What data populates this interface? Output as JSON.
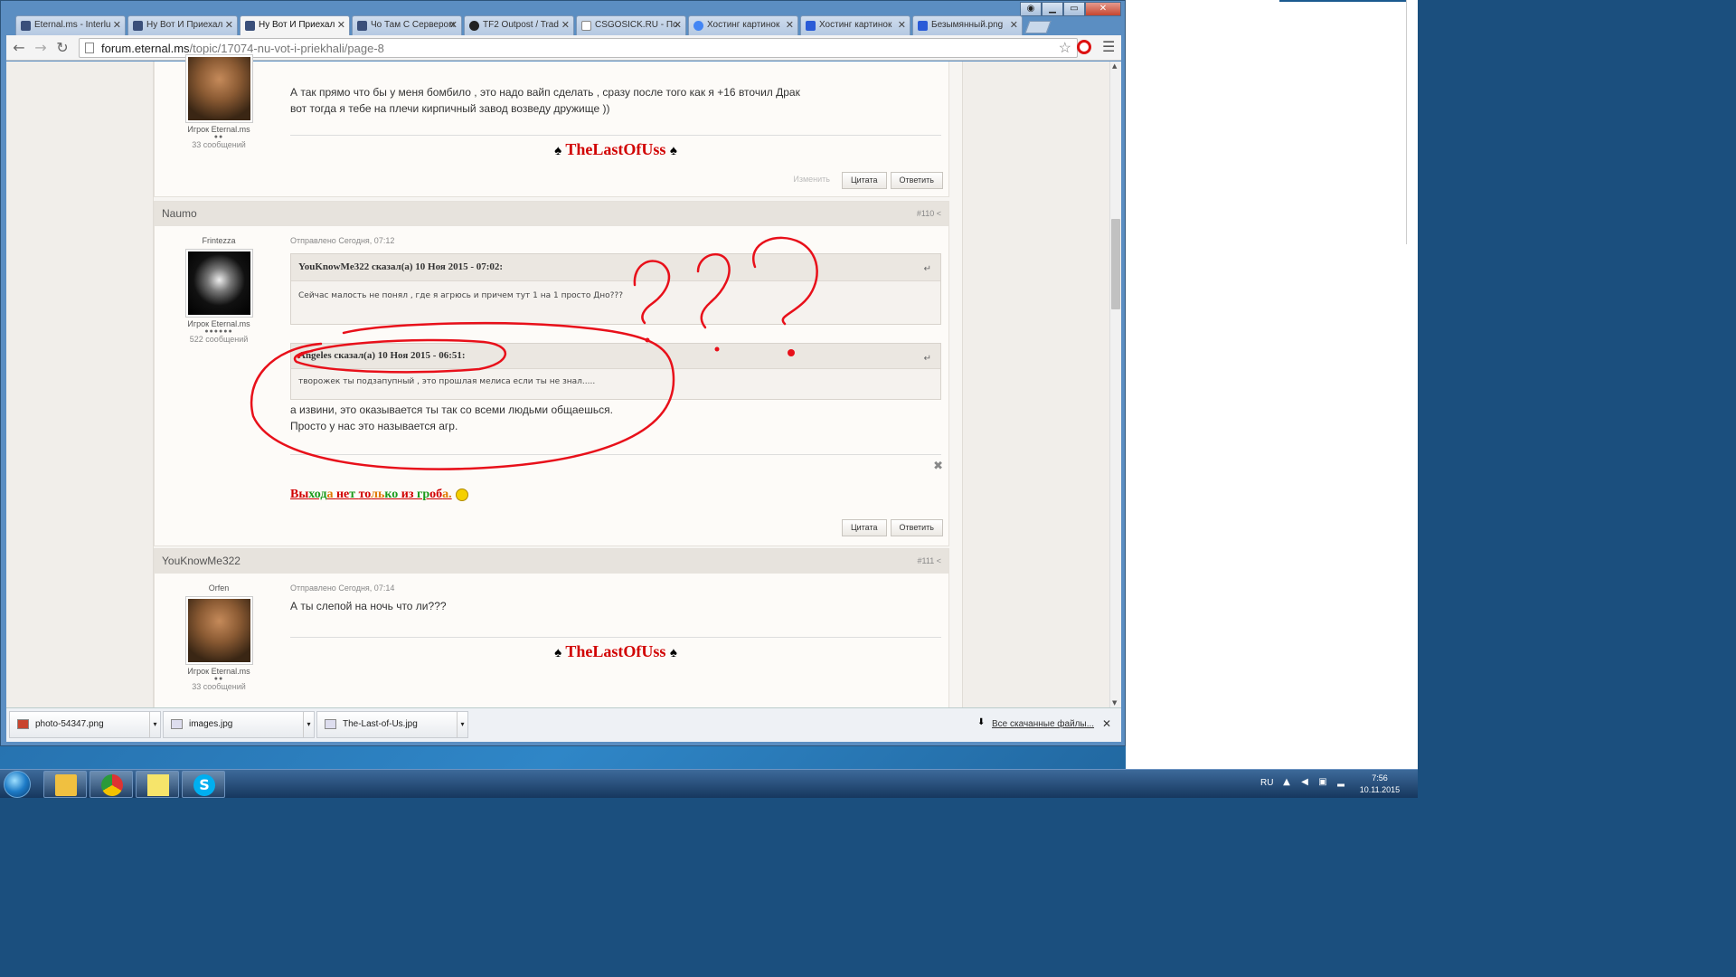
{
  "browser": {
    "tabs": [
      {
        "title": "Eternal.ms - Interlu",
        "favicon": "eternal-icon",
        "color": "#3a4f7a"
      },
      {
        "title": "Ну Вот И Приехал",
        "favicon": "eternal-icon",
        "color": "#3a4f7a"
      },
      {
        "title": "Ну Вот И Приехал",
        "favicon": "eternal-icon",
        "color": "#3a4f7a",
        "active": true
      },
      {
        "title": "Чо Там С Сервером",
        "favicon": "eternal-icon",
        "color": "#3a4f7a"
      },
      {
        "title": "TF2 Outpost / Trad",
        "favicon": "tf2-icon",
        "color": "#222222"
      },
      {
        "title": "CSGOSICK.RU - По",
        "favicon": "page-icon",
        "color": "#ffffff"
      },
      {
        "title": "Хостинг картинок",
        "favicon": "google-icon",
        "color": "#4285f4"
      },
      {
        "title": "Хостинг картинок",
        "favicon": "k-icon",
        "color": "#2a5bd7"
      },
      {
        "title": "Безымянный.png",
        "favicon": "k-icon",
        "color": "#2a5bd7"
      }
    ],
    "url": "forum.eternal.ms/topic/17074-nu-vot-i-priekhali/page-8",
    "url_host": "forum.eternal.ms",
    "url_path": "/topic/17074-nu-vot-i-priekhali/page-8"
  },
  "posts": {
    "top": {
      "rank": "Игрок Eternal.ms",
      "dots": "●●",
      "count": "33 сообщений",
      "text_line1": "А так прямо что бы у меня бомбило , это надо вайп сделать , сразу после того как я +16 вточил Драк",
      "text_line2": "вот тогда я тебе на плечи кирпичный завод возведу  дружище ))",
      "signature": "TheLastOfUss",
      "suit": "♠",
      "edit_label": "Изменить",
      "quote_label": "Цитата",
      "reply_label": "Ответить"
    },
    "p110": {
      "author": "Naumo",
      "number": "#110",
      "server": "Frintezza",
      "rank": "Игрок Eternal.ms",
      "dots": "●●●●●●",
      "count": "522 сообщений",
      "meta": "Отправлено Сегодня, 07:12",
      "quote1_header": "YouKnowMe322 сказал(а) 10 Ноя 2015 - 07:02:",
      "quote1_body": "Сейчас малость не понял , где я агрюсь и причем тут 1 на 1 просто Дно???",
      "quote2_header": "Angeles сказал(а) 10 Ноя 2015 - 06:51:",
      "quote2_body": "творожек ты подзапупный , это прошлая мелиса если ты не знал.....",
      "text_line1": "а извини, это оказывается ты так со всеми людьми общаешься.",
      "text_line2": "Просто у нас это называется агр.",
      "sig_parts": [
        "Вы",
        "ход",
        "а ",
        "не",
        "т ",
        "то",
        "ль",
        "ко ",
        "из ",
        "гр",
        "об",
        "а."
      ],
      "quote_label": "Цитата",
      "reply_label": "Ответить"
    },
    "p111": {
      "author": "YouKnowMe322",
      "number": "#111",
      "server": "Orfen",
      "rank": "Игрок Eternal.ms",
      "dots": "●●",
      "count": "33 сообщений",
      "meta": "Отправлено Сегодня, 07:14",
      "text": "А ты слепой на ночь что ли???",
      "signature": "TheLastOfUss",
      "suit": "♠"
    }
  },
  "downloads": {
    "items": [
      "photo-54347.png",
      "images.jpg",
      "The-Last-of-Us.jpg"
    ],
    "all_label": "Все скачанные файлы..."
  },
  "taskbar": {
    "lang": "RU",
    "time": "7:56",
    "date": "10.11.2015"
  },
  "colors": {
    "annotation_red": "#e8101a",
    "signature_red": "#d10000"
  }
}
